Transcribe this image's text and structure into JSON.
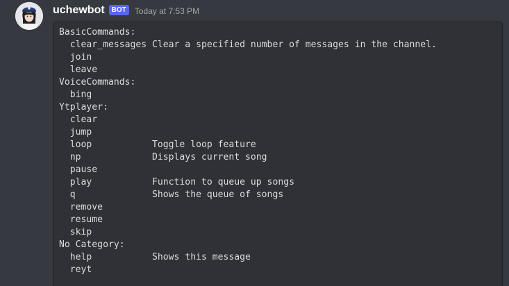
{
  "message": {
    "author": "uchewbot",
    "bot_tag": "BOT",
    "timestamp": "Today at 7:53 PM",
    "avatar_icon": "user-avatar-icon",
    "colors": {
      "background": "#36393f",
      "codeblock_bg": "#2f3136",
      "bot_tag": "#5865f2",
      "text": "#dcddde"
    },
    "code_lines": [
      "BasicCommands:",
      "  clear_messages Clear a specified number of messages in the channel.",
      "  join",
      "  leave",
      "VoiceCommands:",
      "  bing",
      "Ytplayer:",
      "  clear",
      "  jump",
      "  loop           Toggle loop feature",
      "  np             Displays current song",
      "  pause",
      "  play           Function to queue up songs",
      "  q              Shows the queue of songs",
      "  remove",
      "  resume",
      "  skip",
      "No Category:",
      "  help           Shows this message",
      "  reyt"
    ]
  }
}
